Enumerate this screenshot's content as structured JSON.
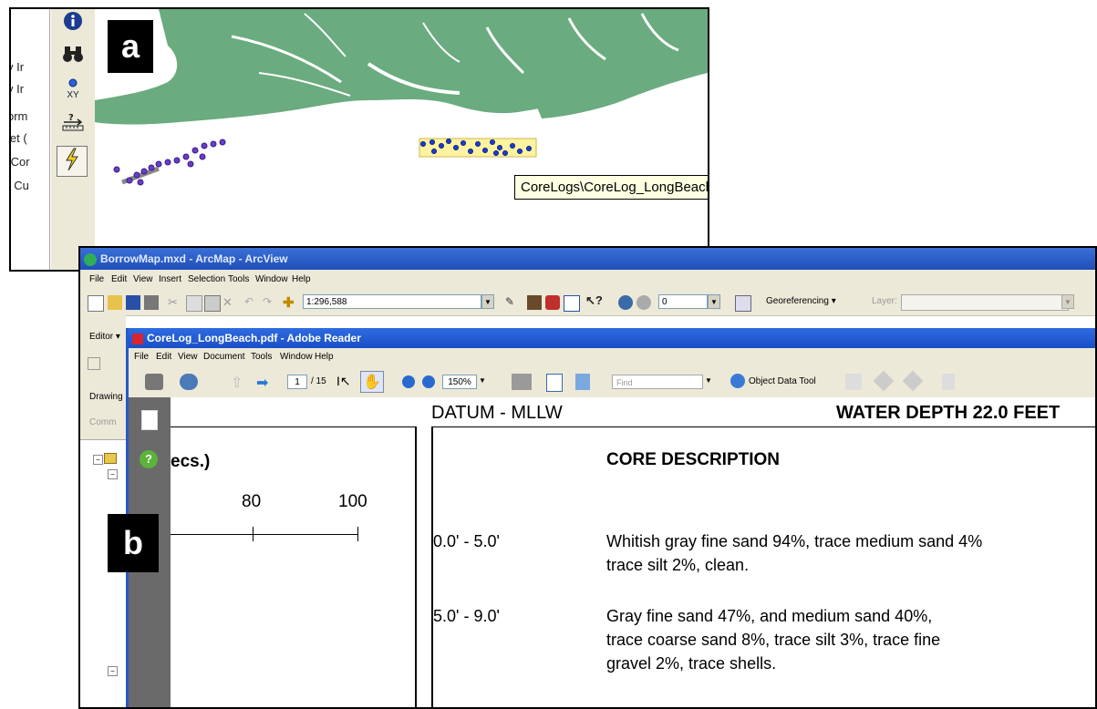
{
  "panel_a": {
    "label": "a",
    "left_column_fragments": [
      "y Ir",
      "y Ir",
      "orm",
      "let (",
      "[Cor",
      ", Cu"
    ],
    "toolbar_tools": [
      {
        "icon": "info-icon",
        "glyph": "i"
      },
      {
        "icon": "binoculars-icon",
        "glyph": "∴"
      },
      {
        "icon": "goto-xy-icon",
        "glyph": "XY"
      },
      {
        "icon": "measure-icon",
        "glyph": "⇄"
      },
      {
        "icon": "hyperlink-lightning-icon",
        "glyph": "ϟ"
      }
    ],
    "tooltip": "CoreLogs\\CoreLog_LongBeach.pdf",
    "colors": {
      "land": "#6aab7f",
      "points": "#6a3ec7",
      "selected_points": "#1a3ed6",
      "selection_fill": "#fff3a0"
    }
  },
  "panel_b": {
    "label": "b",
    "arcmap": {
      "title": "BorrowMap.mxd - ArcMap - ArcView",
      "menu": [
        "File",
        "Edit",
        "View",
        "Insert",
        "Selection",
        "Tools",
        "Window",
        "Help"
      ],
      "scale_value": "1:296,588",
      "layer_value": "0",
      "georeferencing_label": "Georeferencing ▾",
      "layer_label": "Layer:",
      "side_labels": [
        "Editor ▾",
        "Drawing",
        "Comm"
      ]
    },
    "reader": {
      "title": "CoreLog_LongBeach.pdf - Adobe Reader",
      "menu": [
        "File",
        "Edit",
        "View",
        "Document",
        "Tools",
        "Window",
        "Help"
      ],
      "page_current": "1",
      "page_total": "/ 15",
      "zoom": "150%",
      "find_placeholder": "Find",
      "object_data_tool": "Object Data Tool"
    },
    "document": {
      "datum": "DATUM - MLLW",
      "water_depth": "WATER DEPTH 22.0 FEET",
      "left_header": "ecs.)",
      "ticks": [
        "80",
        "100"
      ],
      "section_title": "CORE DESCRIPTION",
      "entries": [
        {
          "depth": "0.0' - 5.0'",
          "lines": [
            "Whitish gray fine sand 94%,  trace medium sand 4%",
            "trace silt 2%, clean."
          ]
        },
        {
          "depth": "5.0' - 9.0'",
          "lines": [
            "Gray fine sand 47%, and medium sand 40%,",
            "trace coarse sand 8%, trace silt 3%, trace fine",
            "gravel 2%, trace shells."
          ]
        }
      ]
    }
  }
}
